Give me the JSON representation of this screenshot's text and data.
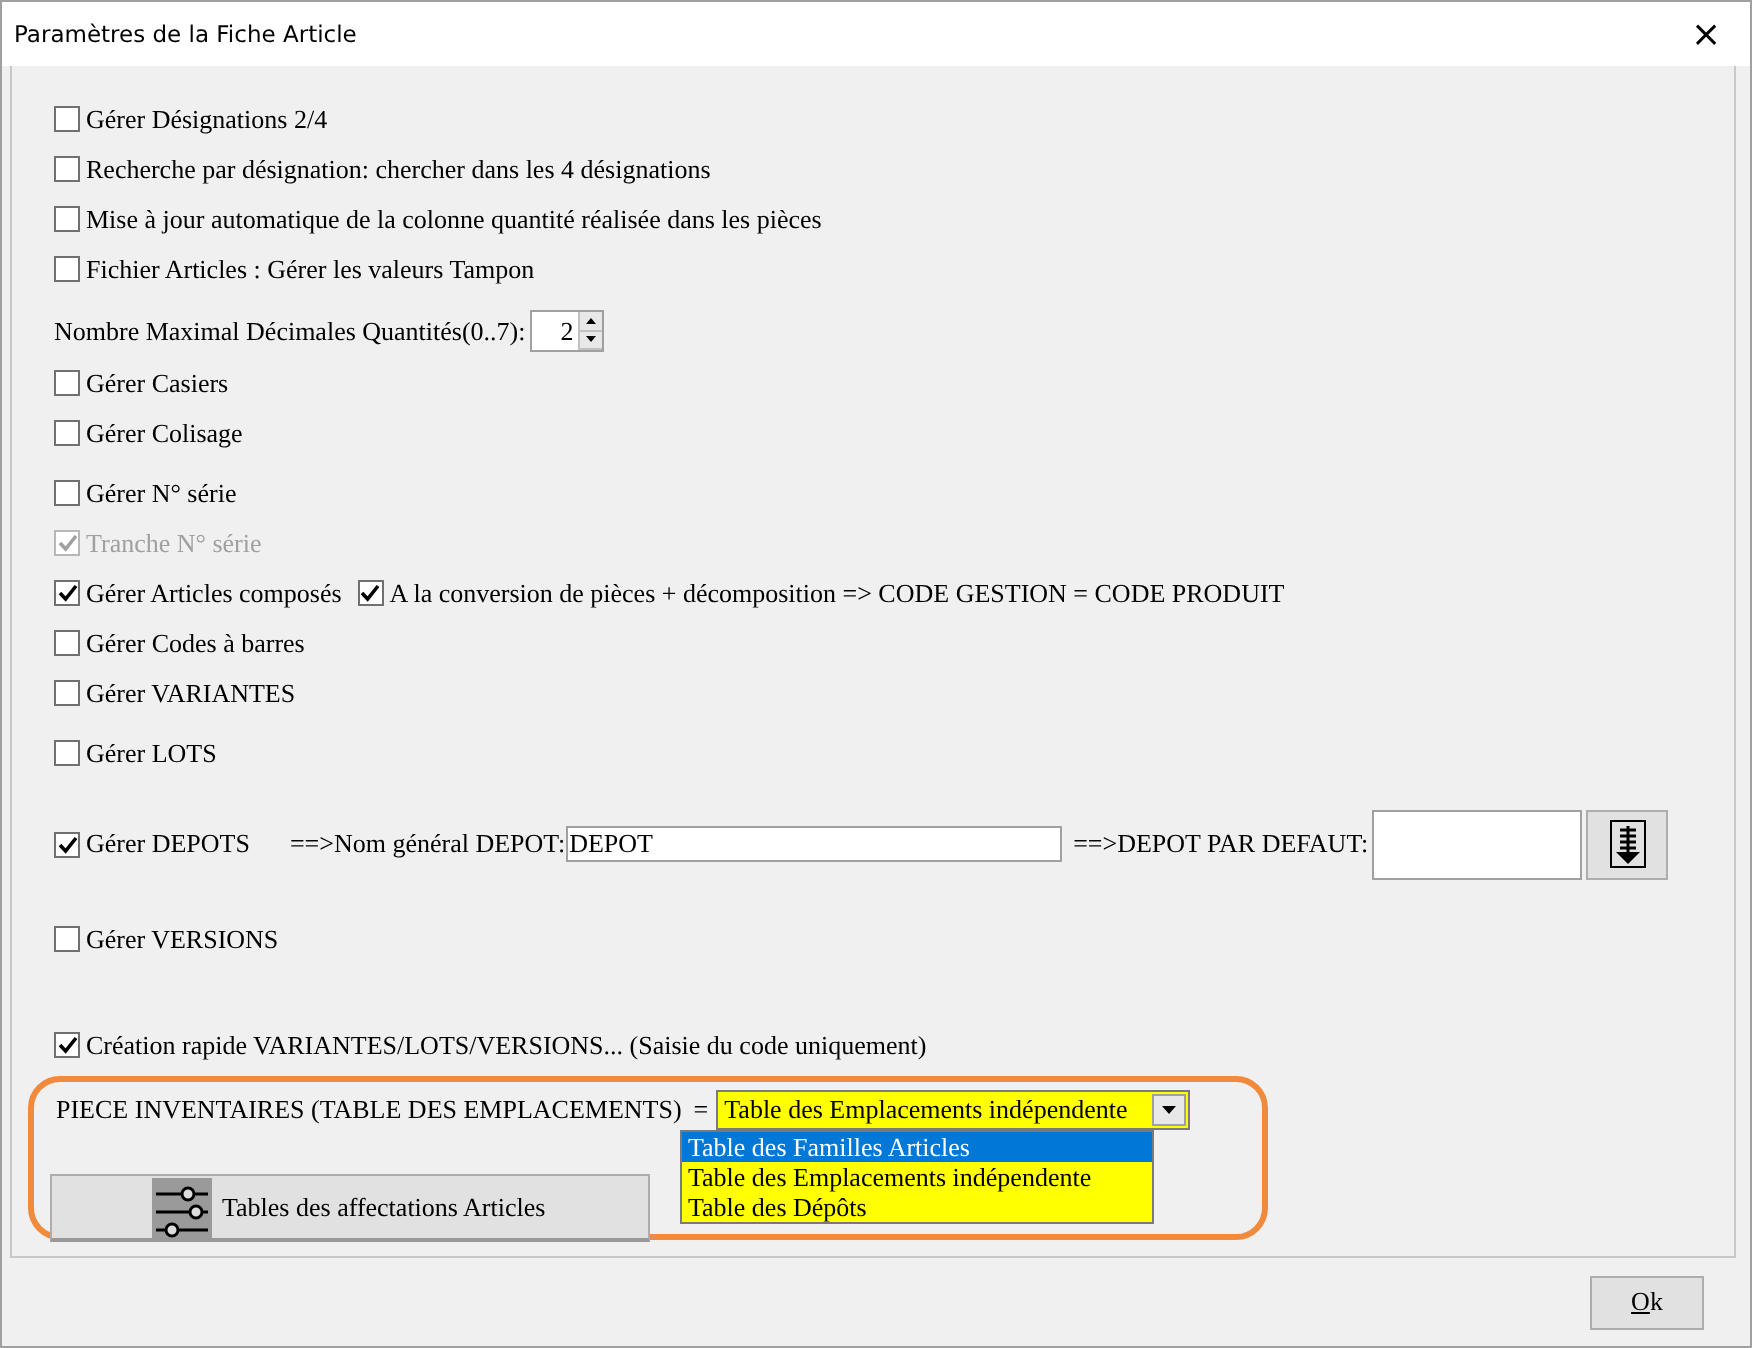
{
  "window": {
    "title": "Paramètres de la Fiche Article",
    "close": "×"
  },
  "options": [
    {
      "kind": "checkbox",
      "label": "Gérer Désignations 2/4",
      "checked": false,
      "disabled": false
    },
    {
      "kind": "checkbox",
      "label": "Recherche par désignation: chercher dans les 4 désignations",
      "checked": false,
      "disabled": false
    },
    {
      "kind": "checkbox",
      "label": "Mise à jour automatique de la colonne quantité réalisée dans les pièces",
      "checked": false,
      "disabled": false
    },
    {
      "kind": "checkbox",
      "label": "Fichier Articles : Gérer les valeurs Tampon",
      "checked": false,
      "disabled": false
    },
    {
      "kind": "spinner",
      "label": "Nombre Maximal Décimales Quantités(0..7):",
      "value": "2"
    },
    {
      "kind": "checkbox",
      "label": "Gérer Casiers",
      "checked": false,
      "disabled": false
    },
    {
      "kind": "checkbox",
      "label": "Gérer Colisage",
      "checked": false,
      "disabled": false
    },
    {
      "kind": "checkbox",
      "label": "Gérer N° série",
      "checked": false,
      "disabled": false
    },
    {
      "kind": "checkbox",
      "label": "Tranche N° série",
      "checked": true,
      "disabled": true
    },
    {
      "kind": "pair",
      "label": "Gérer Articles composés",
      "checked": true,
      "disabled": false,
      "second": {
        "label": "A la conversion de pièces + décomposition => CODE GESTION = CODE PRODUIT",
        "checked": true,
        "disabled": false
      }
    },
    {
      "kind": "checkbox",
      "label": "Gérer Codes à barres",
      "checked": false,
      "disabled": false
    },
    {
      "kind": "checkbox",
      "label": "Gérer VARIANTES",
      "checked": false,
      "disabled": false
    },
    {
      "kind": "checkbox",
      "label": "Gérer LOTS",
      "checked": false,
      "disabled": false
    },
    {
      "kind": "depots",
      "label": "Gérer DEPOTS",
      "checked": true,
      "disabled": false,
      "name_label": "==>Nom général DEPOT:",
      "name_value": "DEPOT",
      "default_label": "==>DEPOT PAR DEFAUT:"
    },
    {
      "kind": "checkbox",
      "label": "Gérer VERSIONS",
      "checked": false,
      "disabled": false
    },
    {
      "kind": "checkbox",
      "label": "Création rapide VARIANTES/LOTS/VERSIONS... (Saisie du code uniquement)",
      "checked": true,
      "disabled": false
    }
  ],
  "inventory": {
    "label": "PIECE INVENTAIRES (TABLE DES EMPLACEMENTS)",
    "equals": "=",
    "value": "Table des Emplacements indépendente",
    "choices": [
      {
        "label": "Table des Familles Articles",
        "highlighted": true
      },
      {
        "label": "Table des Emplacements indépendente",
        "highlighted": false
      },
      {
        "label": "Table des Dépôts",
        "highlighted": false
      }
    ]
  },
  "assign_button": "Tables des affectations Articles",
  "ok_button": "Ok"
}
